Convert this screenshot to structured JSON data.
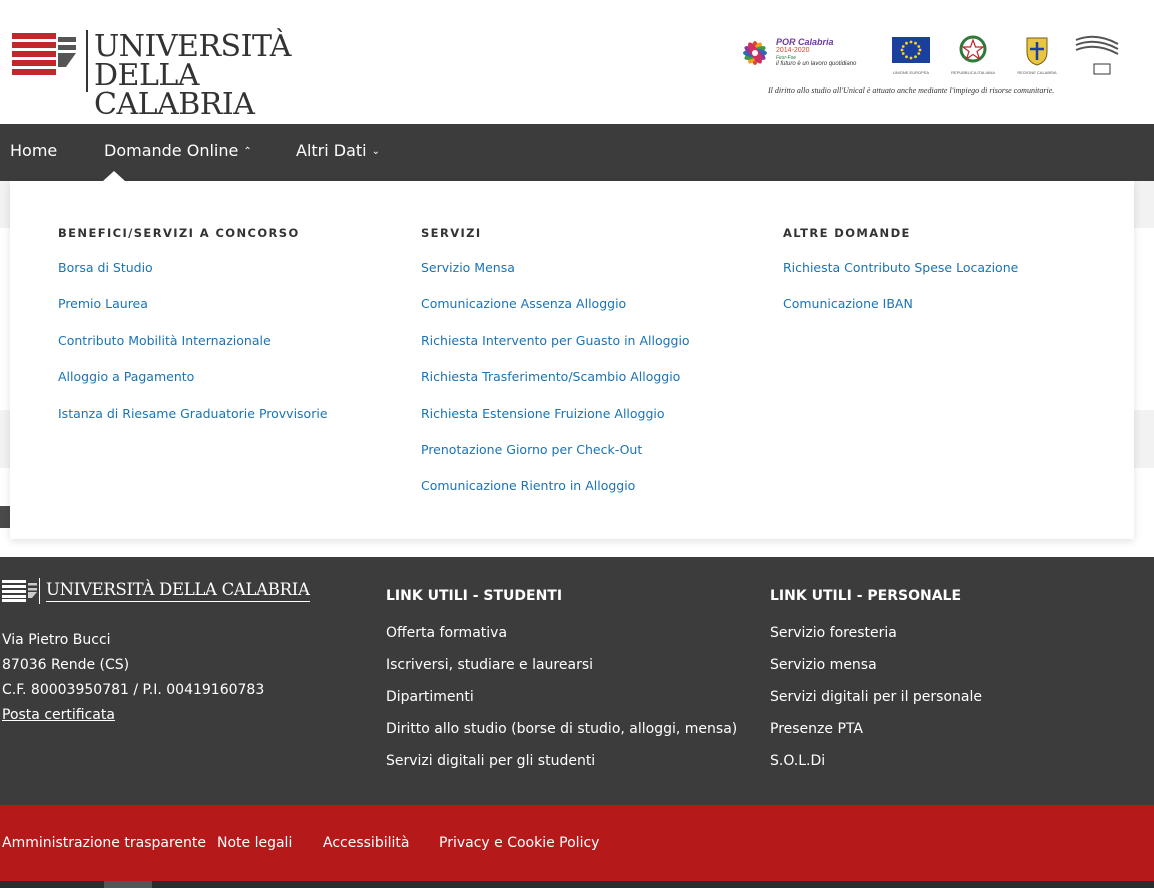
{
  "header": {
    "logo_line1": "UNIVERSITÀ",
    "logo_line2": "DELLA CALABRIA",
    "por_title": "POR Calabria",
    "por_years": "2014-2020",
    "por_sub": "Fesr-Fse",
    "por_motto": "il futuro è un lavoro quotidiano",
    "emblem_eu": "UNIONE EUROPEA",
    "emblem_it": "REPUBBLICA ITALIANA",
    "emblem_cal": "REGIONE CALABRIA",
    "partners_note": "Il diritto allo studio all'Unical è attuato anche mediante l'impiego di risorse comunitarie."
  },
  "nav": {
    "items": [
      {
        "label": "Home"
      },
      {
        "label": "Domande Online",
        "icon": "chevron-up-icon"
      },
      {
        "label": "Altri Dati",
        "icon": "chevron-down-icon"
      }
    ]
  },
  "dropdown": {
    "columns": [
      {
        "heading": "BENEFICI/SERVIZI A CONCORSO",
        "links": [
          "Borsa di Studio",
          "Premio Laurea",
          "Contributo Mobilità Internazionale",
          "Alloggio a Pagamento",
          "Istanza di Riesame Graduatorie Provvisorie"
        ]
      },
      {
        "heading": "SERVIZI",
        "links": [
          "Servizio Mensa",
          "Comunicazione Assenza Alloggio",
          "Richiesta Intervento per Guasto in Alloggio",
          "Richiesta Trasferimento/Scambio Alloggio",
          "Richiesta Estensione Fruizione Alloggio",
          "Prenotazione Giorno per Check-Out",
          "Comunicazione Rientro in Alloggio"
        ]
      },
      {
        "heading": "ALTRE DOMANDE",
        "links": [
          "Richiesta Contributo Spese Locazione",
          "Comunicazione IBAN"
        ]
      }
    ]
  },
  "footer": {
    "logo_text": "UNIVERSITÀ DELLA CALABRIA",
    "address": [
      "Via Pietro Bucci",
      "87036 Rende (CS)",
      "C.F. 80003950781 / P.I. 00419160783"
    ],
    "pec": "Posta certificata",
    "columns": [
      {
        "heading": "LINK UTILI - STUDENTI",
        "links": [
          "Offerta formativa",
          "Iscriversi, studiare e laurearsi",
          "Dipartimenti",
          "Diritto allo studio (borse di studio, alloggi, mensa)",
          "Servizi digitali per gli studenti"
        ]
      },
      {
        "heading": "LINK UTILI - PERSONALE",
        "links": [
          "Servizio foresteria",
          "Servizio mensa",
          "Servizi digitali per il personale",
          "Presenze PTA",
          "S.O.L.Di"
        ]
      }
    ]
  },
  "bottom": {
    "links": [
      "Amministrazione trasparente",
      "Note legali",
      "Accessibilità",
      "Privacy e Cookie Policy"
    ]
  },
  "colors": {
    "nav_bg": "#3c3c3c",
    "link": "#1a73b5",
    "brand_red": "#b5191a",
    "logo_red": "#c0282b"
  }
}
